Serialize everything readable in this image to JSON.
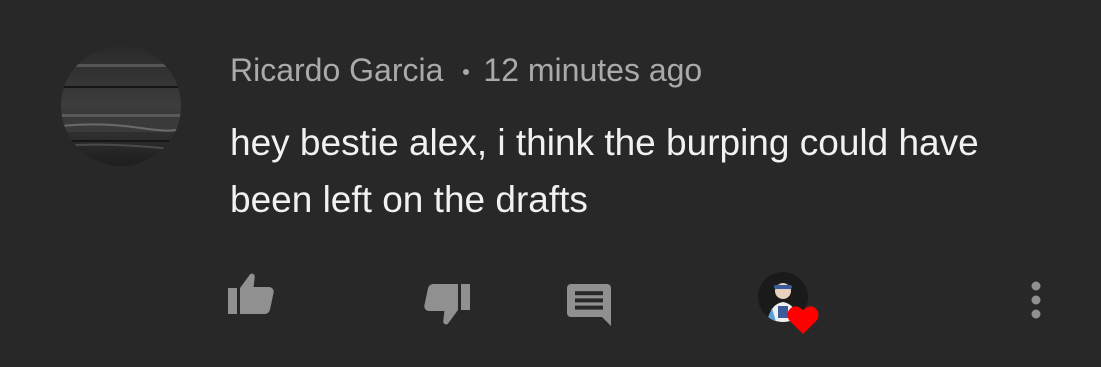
{
  "comment": {
    "author": "Ricardo Garcia",
    "timestamp": "12 minutes ago",
    "text": "hey bestie alex, i think the burping could have been left on the drafts"
  },
  "icons": {
    "avatar": "user-avatar-wood-texture",
    "like": "thumb-up-icon",
    "dislike": "thumb-down-icon",
    "reply": "comment-reply-icon",
    "creator_heart": "creator-heart-icon",
    "more": "more-vertical-icon"
  },
  "colors": {
    "background": "#282828",
    "text_primary": "#f1f1f1",
    "text_secondary": "#aaaaaa",
    "icon": "#909090",
    "heart": "#ff0000"
  }
}
